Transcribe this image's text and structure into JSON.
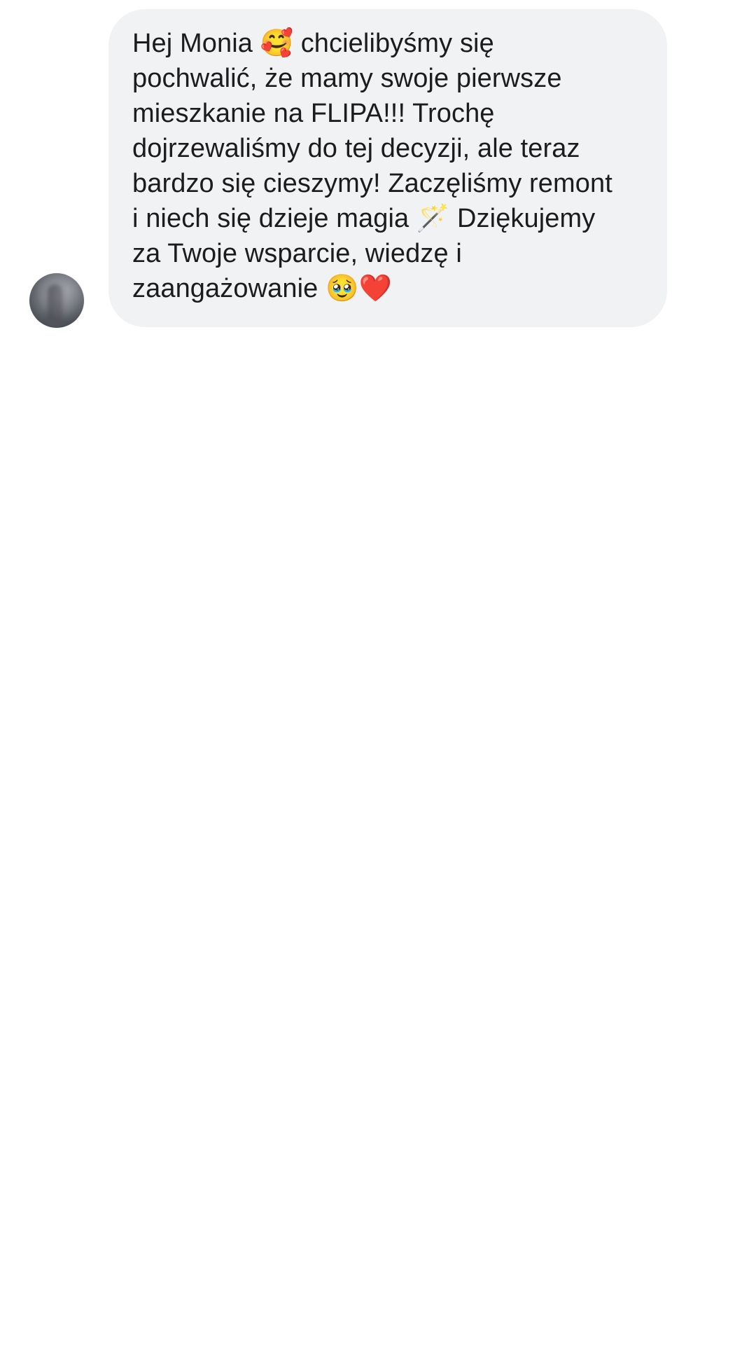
{
  "conversation": {
    "message": {
      "text": "Hej Monia 🥰 chcielibyśmy się\npochwalić, że mamy swoje pierwsze\nmieszkanie na FLIPA!!! Trochę\ndojrzewaliśmy do tej decyzji, ale teraz\nbardzo się cieszymy! Zaczęliśmy remont\ni niech się dzieje magia 🪄 Dziękujemy\nza Twoje wsparcie, wiedzę i\nzaangażowanie 🥹❤️"
    },
    "sender": {
      "avatar_icon": "blurred-profile-photo"
    }
  },
  "colors": {
    "bubble_background": "#f1f2f4",
    "text": "#1c1c1e",
    "page_background": "#ffffff"
  }
}
